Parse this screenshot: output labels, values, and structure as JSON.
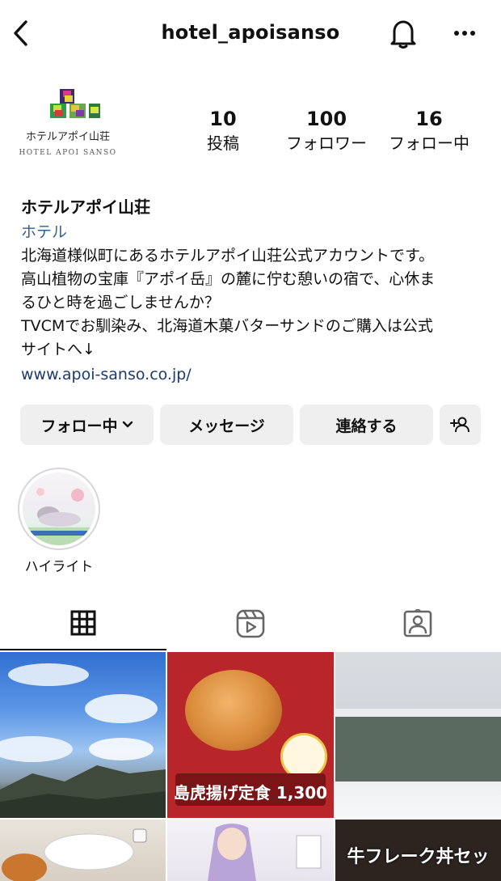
{
  "header": {
    "username": "hotel_apoisanso"
  },
  "profile": {
    "logo_text": "ホテルアポイ山荘",
    "logo_sub": "HOTEL APOI SANSO",
    "stats": {
      "posts": {
        "value": "10",
        "label": "投稿"
      },
      "followers": {
        "value": "100",
        "label": "フォロワー"
      },
      "following": {
        "value": "16",
        "label": "フォロー中"
      }
    }
  },
  "bio": {
    "name": "ホテルアポイ山荘",
    "category": "ホテル",
    "lines": [
      "北海道様似町にあるホテルアポイ山荘公式アカウントです。",
      "高山植物の宝庫『アポイ岳』の麓に佇む憩いの宿で、心休ま",
      "るひと時を過ごしませんか？",
      "TVCMでお馴染み、北海道木菓バターサンドのご購入は公式",
      "サイトへ↓"
    ],
    "link": "www.apoi-sanso.co.jp/"
  },
  "actions": {
    "following": "フォロー中",
    "message": "メッセージ",
    "contact": "連絡する"
  },
  "highlight": {
    "label": "ハイライト"
  },
  "grid": {
    "post2_text": "島虎揚げ定食 1,300",
    "post6_text": "牛フレーク丼セッ"
  },
  "icons": {
    "back": "chevron-left-icon",
    "bell": "bell-icon",
    "more": "more-horizontal-icon",
    "chevron": "chevron-down-icon",
    "add_person": "add-person-icon",
    "grid": "grid-icon",
    "reels": "reels-icon",
    "tagged": "tagged-icon"
  }
}
